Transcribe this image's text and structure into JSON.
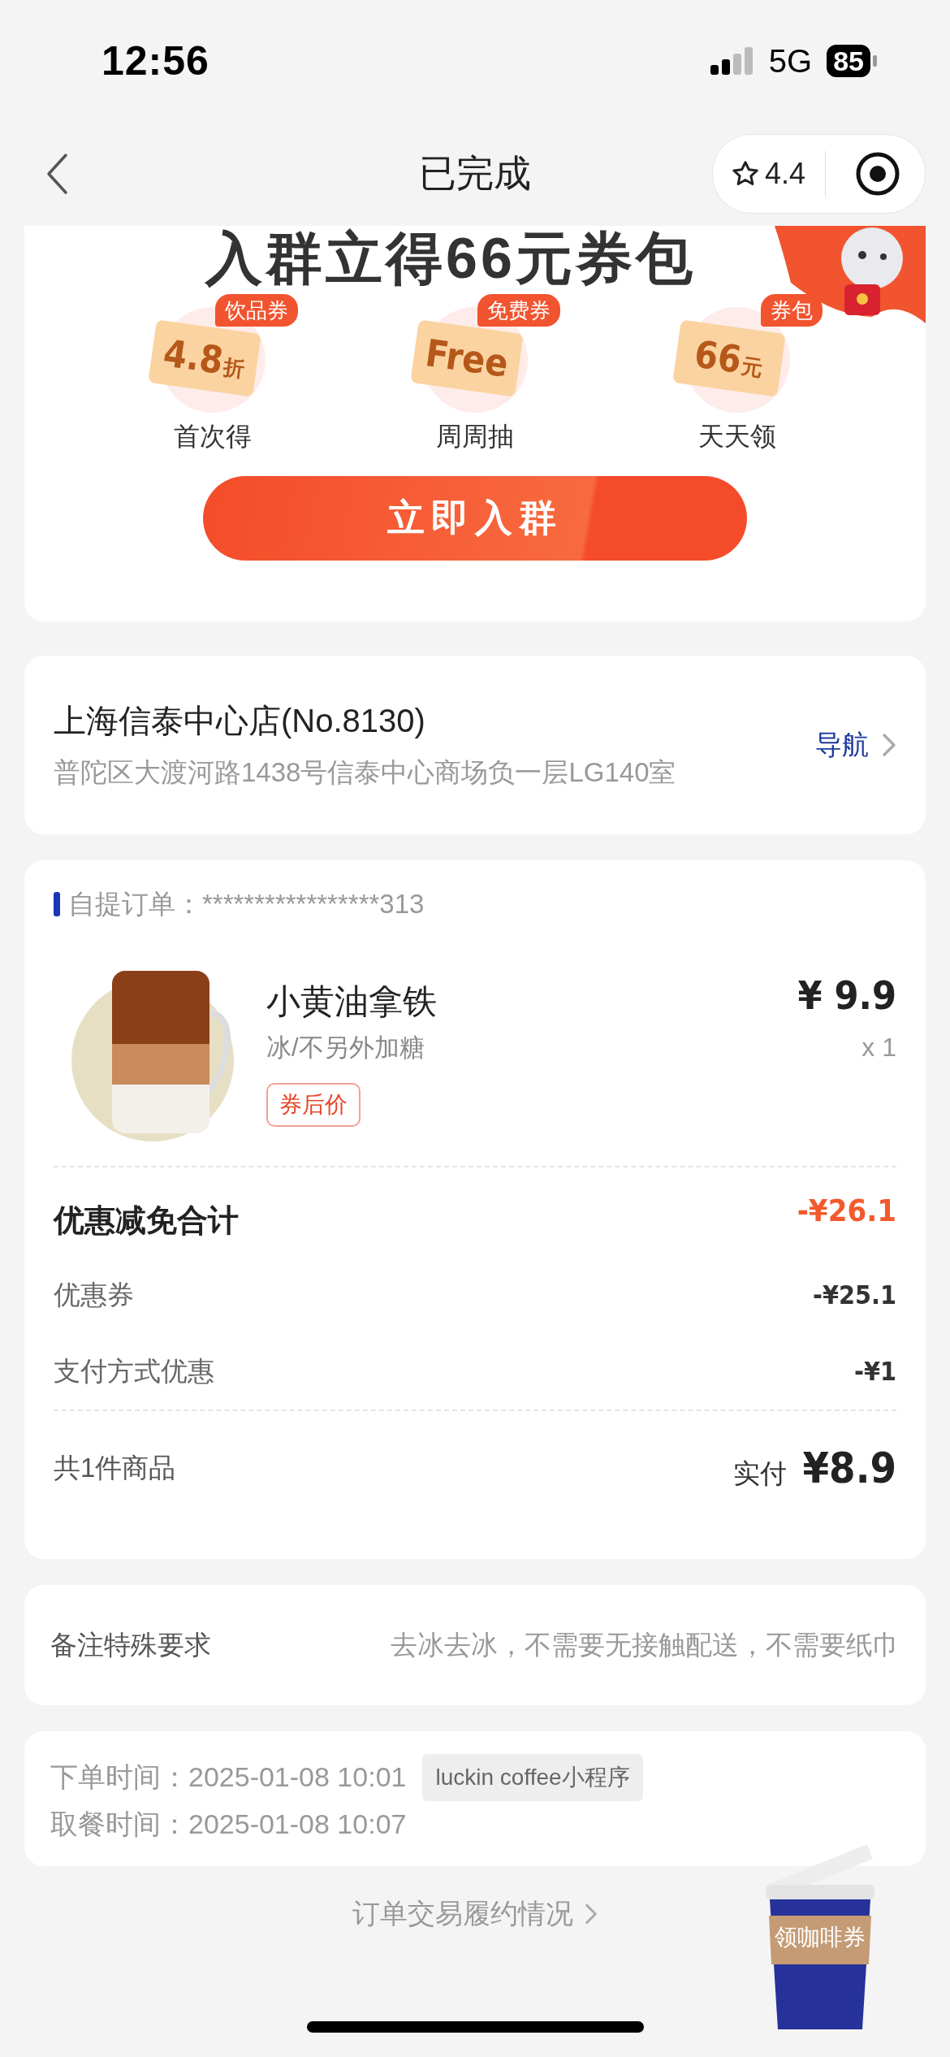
{
  "status_bar": {
    "time": "12:56",
    "network": "5G",
    "battery": "85"
  },
  "nav": {
    "title": "已完成",
    "rating": "4.4"
  },
  "promo": {
    "headline": "入群立得66元券包",
    "perks": [
      {
        "tag": "饮品券",
        "value": "4.8",
        "unit": "折",
        "caption": "首次得"
      },
      {
        "tag": "免费券",
        "value": "Free",
        "caption": "周周抽"
      },
      {
        "tag": "券包",
        "value": "66",
        "unit": "元",
        "caption": "天天领"
      }
    ],
    "button": "立即入群"
  },
  "store": {
    "name": "上海信泰中心店(No.8130)",
    "address": "普陀区大渡河路1438号信泰中心商场负一层LG140室",
    "nav_link": "导航"
  },
  "order": {
    "label": "自提订单：",
    "number": "*****************313",
    "item": {
      "name": "小黄油拿铁",
      "options": "冰/不另外加糖",
      "tag": "券后价",
      "price": "¥ 9.9",
      "quantity": "x 1"
    },
    "discount_total": {
      "label": "优惠减免合计",
      "value": "-¥26.1"
    },
    "discounts": [
      {
        "label": "优惠券",
        "value": "-¥25.1"
      },
      {
        "label": "支付方式优惠",
        "value": "-¥1"
      }
    ],
    "summary": {
      "count": "共1件商品",
      "paid_label": "实付",
      "paid": "¥8.9"
    }
  },
  "remark": {
    "label": "备注特殊要求",
    "value": "去冰去冰，不需要无接触配送，不需要纸巾"
  },
  "times": [
    {
      "label": "下单时间：",
      "value": "2025-01-08 10:01",
      "badge": "luckin coffee小程序"
    },
    {
      "label": "取餐时间：",
      "value": "2025-01-08 10:07"
    }
  ],
  "footer_link": "订单交易履约情况",
  "float_button": "领咖啡券"
}
